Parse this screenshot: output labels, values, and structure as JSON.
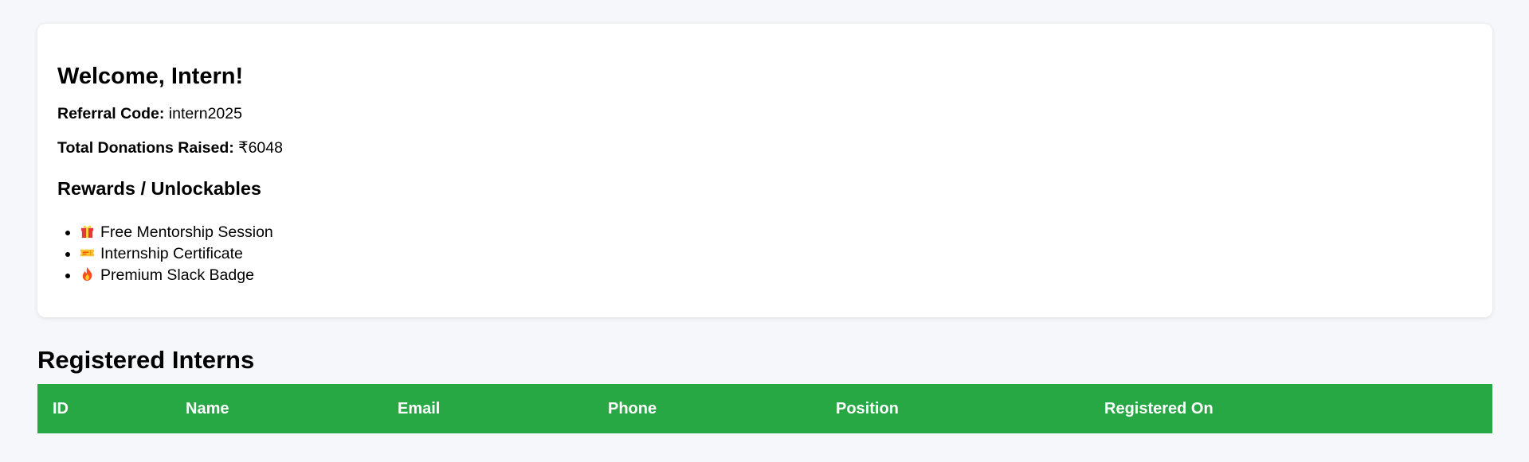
{
  "welcome": {
    "title": "Welcome, Intern!",
    "referral_label": "Referral Code:",
    "referral_value": "intern2025",
    "donations_label": "Total Donations Raised:",
    "donations_value": "₹6048"
  },
  "rewards": {
    "heading": "Rewards / Unlockables",
    "items": [
      {
        "icon": "gift-icon",
        "label": "Free Mentorship Session"
      },
      {
        "icon": "ticket-icon",
        "label": "Internship Certificate"
      },
      {
        "icon": "fire-icon",
        "label": "Premium Slack Badge"
      }
    ]
  },
  "interns": {
    "title": "Registered Interns",
    "columns": [
      "ID",
      "Name",
      "Email",
      "Phone",
      "Position",
      "Registered On"
    ],
    "rows": []
  },
  "colors": {
    "page_background": "#f5f7fa",
    "card_background": "#ffffff",
    "table_header": "#28a745",
    "table_header_text": "#ffffff"
  }
}
